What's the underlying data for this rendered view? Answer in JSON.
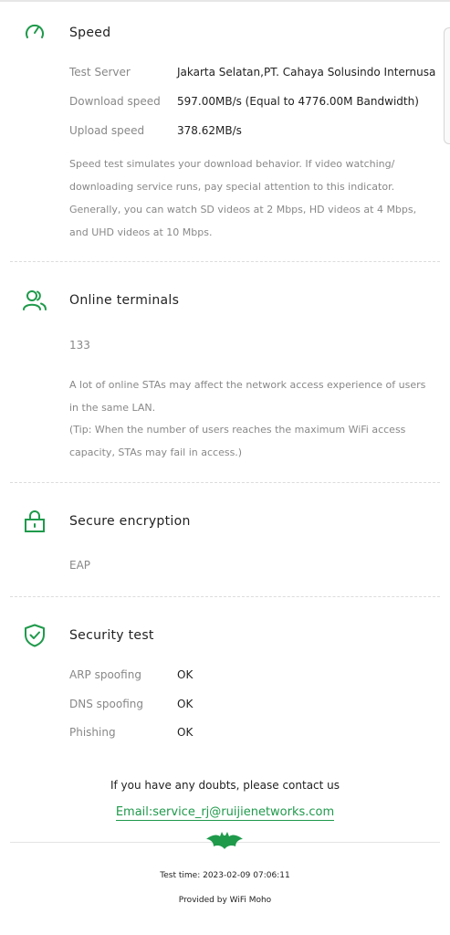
{
  "speed": {
    "title": "Speed",
    "icon": "speedometer-icon",
    "rows": [
      {
        "label": "Test Server",
        "value": "Jakarta Selatan,PT. Cahaya Solusindo Internusa"
      },
      {
        "label": "Download speed",
        "value": "597.00MB/s  (Equal to 4776.00M Bandwidth)"
      },
      {
        "label": "Upload speed",
        "value": "378.62MB/s"
      }
    ],
    "description": "Speed test simulates your download behavior. If video watching/ downloading service runs, pay special attention to this indicator. Generally, you can watch SD videos at 2 Mbps, HD videos at 4 Mbps, and UHD videos at 10 Mbps."
  },
  "terminals": {
    "title": "Online terminals",
    "icon": "users-icon",
    "count": "133",
    "description": "A lot of online STAs may affect the network access experience of users in the same LAN.",
    "tip": "(Tip: When the number of users reaches the maximum WiFi access capacity, STAs may fail in access.)"
  },
  "encryption": {
    "title": "Secure encryption",
    "icon": "lock-icon",
    "value": "EAP"
  },
  "security": {
    "title": "Security test",
    "icon": "shield-check-icon",
    "rows": [
      {
        "label": "ARP spoofing",
        "value": "OK"
      },
      {
        "label": "DNS spoofing",
        "value": "OK"
      },
      {
        "label": "Phishing",
        "value": "OK"
      }
    ]
  },
  "contact": {
    "text": "If you have any doubts, please contact us",
    "email": "Email:service_rj@ruijienetworks.com"
  },
  "footer": {
    "logo": "bat-logo-icon",
    "test_time": "Test time:  2023-02-09 07:06:11",
    "provided_by": "Provided by WiFi Moho"
  },
  "colors": {
    "accent": "#1f9a4b",
    "label": "#888888",
    "text": "#222222"
  }
}
